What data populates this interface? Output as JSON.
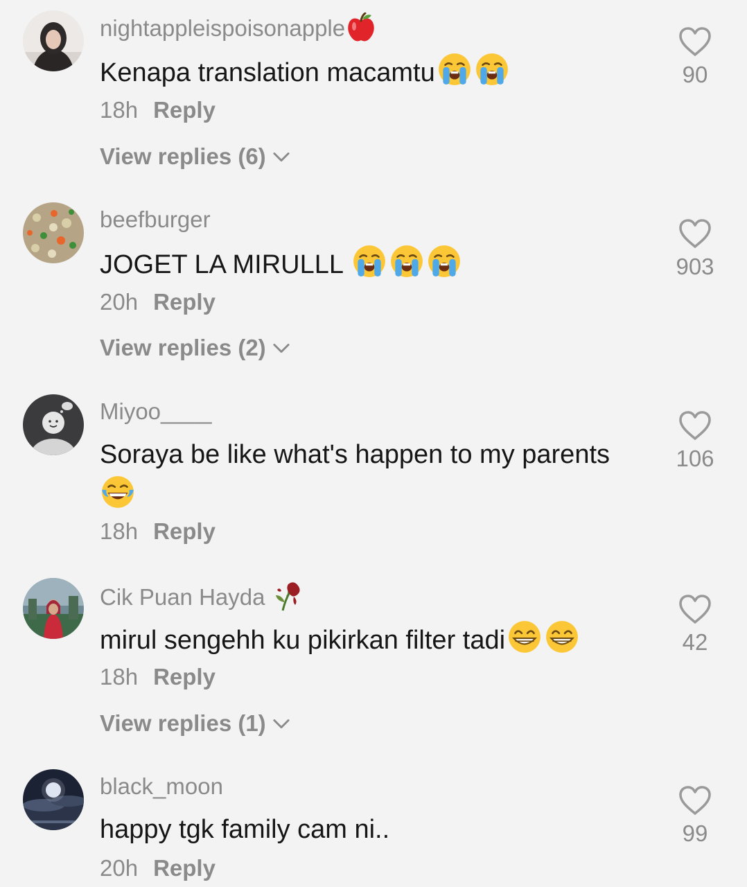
{
  "comments": [
    {
      "username": "nightappleispoisonapple",
      "username_emoji": "red-apple-icon",
      "text": "Kenapa translation macamtu",
      "emojis": [
        "loudly-crying-face-icon",
        "loudly-crying-face-icon"
      ],
      "time": "18h",
      "reply_label": "Reply",
      "view_replies": "View replies (6)",
      "likes": "90"
    },
    {
      "username": "beefburger",
      "text": "JOGET LA MIRULLL ",
      "emojis": [
        "loudly-crying-face-icon",
        "loudly-crying-face-icon",
        "loudly-crying-face-icon"
      ],
      "time": "20h",
      "reply_label": "Reply",
      "view_replies": "View replies (2)",
      "likes": "903"
    },
    {
      "username": "Miyoo____",
      "text": "Soraya be like what's happen to my parents",
      "emojis": [
        "tears-of-joy-face-icon"
      ],
      "time": "18h",
      "reply_label": "Reply",
      "likes": "106"
    },
    {
      "username": "Cik Puan Hayda ",
      "username_emoji": "wilted-flower-icon",
      "text": "mirul sengehh ku pikirkan filter tadi",
      "emojis": [
        "grinning-face-icon",
        "grinning-face-icon"
      ],
      "time": "18h",
      "reply_label": "Reply",
      "view_replies": "View replies (1)",
      "likes": "42"
    },
    {
      "username": "black_moon",
      "text": "happy tgk family cam ni..",
      "time": "20h",
      "reply_label": "Reply",
      "likes": "99"
    }
  ],
  "colors": {
    "background": "#f3f3f3",
    "primary_text": "#161616",
    "secondary_text": "#8a8a8a"
  }
}
